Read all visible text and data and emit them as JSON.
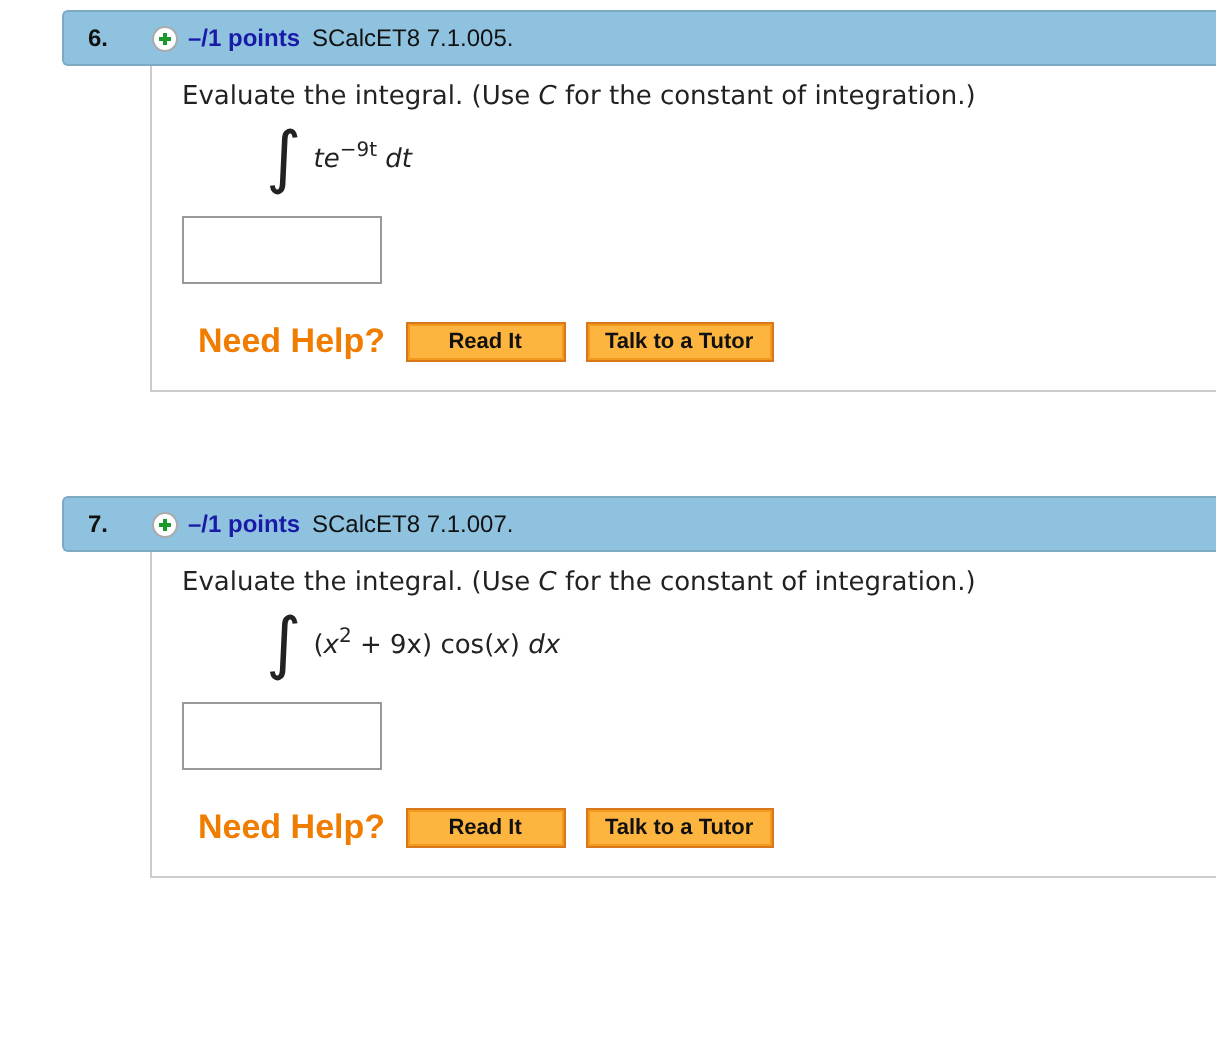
{
  "questions": [
    {
      "number": "6.",
      "points": "–/1 points",
      "code": "SCalcET8 7.1.005.",
      "instruction": "Evaluate the integral. (Use *C* for the constant of integration.)",
      "integral_sign": "∫",
      "integrand": "*te*$^{−9t}$ *dt*",
      "help_label": "Need Help?",
      "buttons": [
        "Read It",
        "Talk to a Tutor"
      ]
    },
    {
      "number": "7.",
      "points": "–/1 points",
      "code": "SCalcET8 7.1.007.",
      "instruction": "Evaluate the integral. (Use *C* for the constant of integration.)",
      "integral_sign": "∫",
      "integrand": "(*x*$^{2}$ + 9x) cos(*x*) *dx*",
      "help_label": "Need Help?",
      "buttons": [
        "Read It",
        "Talk to a Tutor"
      ]
    }
  ]
}
